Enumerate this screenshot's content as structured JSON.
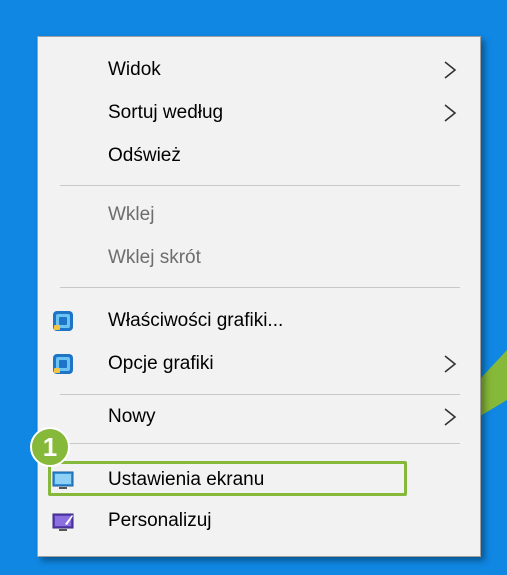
{
  "menu": {
    "items": [
      {
        "label": "Widok"
      },
      {
        "label": "Sortuj według"
      },
      {
        "label": "Odśwież"
      },
      {
        "label": "Wklej"
      },
      {
        "label": "Wklej skrót"
      },
      {
        "label": "Właściwości grafiki..."
      },
      {
        "label": "Opcje grafiki"
      },
      {
        "label": "Nowy"
      },
      {
        "label": "Ustawienia ekranu"
      },
      {
        "label": "Personalizuj"
      }
    ]
  },
  "annotation": {
    "step_number": "1",
    "accent_color": "#86b839"
  },
  "colors": {
    "desktop_background": "#1087e3",
    "menu_background": "#f2f2f2"
  }
}
